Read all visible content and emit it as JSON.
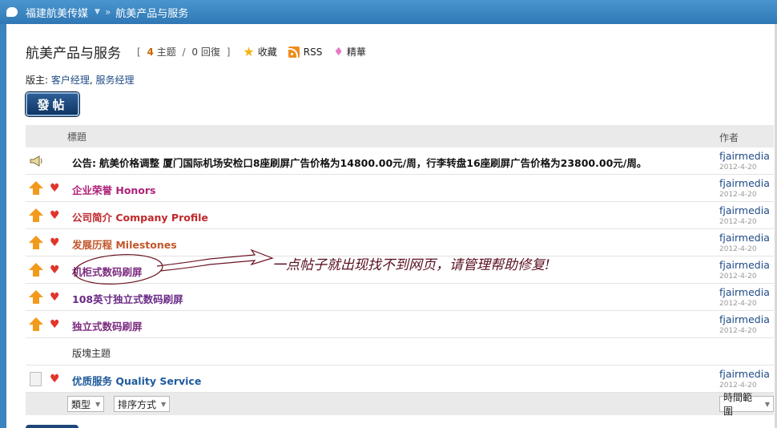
{
  "breadcrumb": {
    "site": "福建航美传媒",
    "separator": "»",
    "section": "航美产品与服务"
  },
  "header": {
    "title": "航美产品与服务",
    "stats_open": "[",
    "topics_count": "4",
    "topics_label": "主题",
    "stats_slash": "/",
    "replies_count": "0",
    "replies_label": "回復",
    "stats_close": "]",
    "favorite_label": "收藏",
    "rss_label": "RSS",
    "digest_label": "精華"
  },
  "moderators": {
    "prefix": "版主:",
    "mod1": "客户经理",
    "comma": ",",
    "mod2": "服务经理"
  },
  "post_button_label": "發帖",
  "table": {
    "col_title": "標題",
    "col_author": "作者",
    "rows": [
      {
        "type": "announcement",
        "prefix": "公告:",
        "title": "航美价格调整 厦门国际机场安检口8座刷屏广告价格为14800.00元/周，行李转盘16座刷屏广告价格为23800.00元/周。",
        "author": "fjairmedia",
        "date": "2012-4-20",
        "color": "#111111"
      },
      {
        "type": "sticky",
        "title": "企业荣誉  Honors",
        "author": "fjairmedia",
        "date": "2012-4-20",
        "color": "#b0227a"
      },
      {
        "type": "sticky",
        "title": "公司简介  Company Profile",
        "author": "fjairmedia",
        "date": "2012-4-20",
        "color": "#c0282c"
      },
      {
        "type": "sticky",
        "title": "发展历程  Milestones",
        "author": "fjairmedia",
        "date": "2012-4-20",
        "color": "#c2562b"
      },
      {
        "type": "sticky",
        "title": "机柜式数码刷屏",
        "author": "fjairmedia",
        "date": "2012-4-20",
        "color": "#7a2a7e"
      },
      {
        "type": "sticky",
        "title": "108英寸独立式数码刷屏",
        "author": "fjairmedia",
        "date": "2012-4-20",
        "color": "#6a2a86"
      },
      {
        "type": "sticky",
        "title": "独立式数码刷屏",
        "author": "fjairmedia",
        "date": "2012-4-20",
        "color": "#7a2a7e"
      }
    ],
    "section_label": "版塊主題",
    "normal_rows": [
      {
        "type": "normal",
        "title": "优质服务  Quality Service",
        "author": "fjairmedia",
        "date": "2012-4-20",
        "color": "#1e5a9c"
      }
    ]
  },
  "filters": {
    "type_label": "類型",
    "sort_label": "排序方式",
    "time_label": "時間範圍"
  },
  "annotation": "一点帖子就出现找不到网页，请管理帮助修复!",
  "colors": {
    "accent": "#2f78b5",
    "arrow": "#f29a1c",
    "heart": "#e0352b",
    "link": "#1e4a86"
  }
}
